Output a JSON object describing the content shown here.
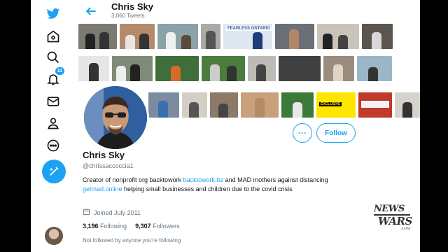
{
  "header": {
    "name": "Chris Sky",
    "tweet_count": "3,060 Tweets"
  },
  "nav": {
    "items": [
      "twitter-logo",
      "home-icon",
      "explore-icon",
      "notifications-icon",
      "messages-icon",
      "profile-icon",
      "more-icon"
    ],
    "notifications_badge": "11"
  },
  "media": {
    "signs": [
      "FEARLESS ONTARIO",
      "EXCLUSIVE"
    ]
  },
  "profile": {
    "name": "Chris Sky",
    "handle": "@chrissaccoccia1",
    "bio": {
      "part1": "Creator of nonprofit org backtowork ",
      "link1": "backtowork.bz",
      "part2": " and MAD mothers against distancing ",
      "link2": "getmad.online",
      "part3": " helping small businesses and children due to the covid crisis"
    },
    "joined": "Joined July 2011",
    "following_count": "3,196",
    "following_label": "Following",
    "followers_count": "9,307",
    "followers_label": "Followers",
    "not_followed": "Not followed by anyone you're following",
    "more_label": "···",
    "follow_label": "Follow"
  },
  "watermark": {
    "line1": "NEWS",
    "line2": "WARS",
    "line3": ".COM"
  },
  "colors": {
    "accent": "#1da1f2",
    "text": "#14171a",
    "muted": "#657786"
  }
}
